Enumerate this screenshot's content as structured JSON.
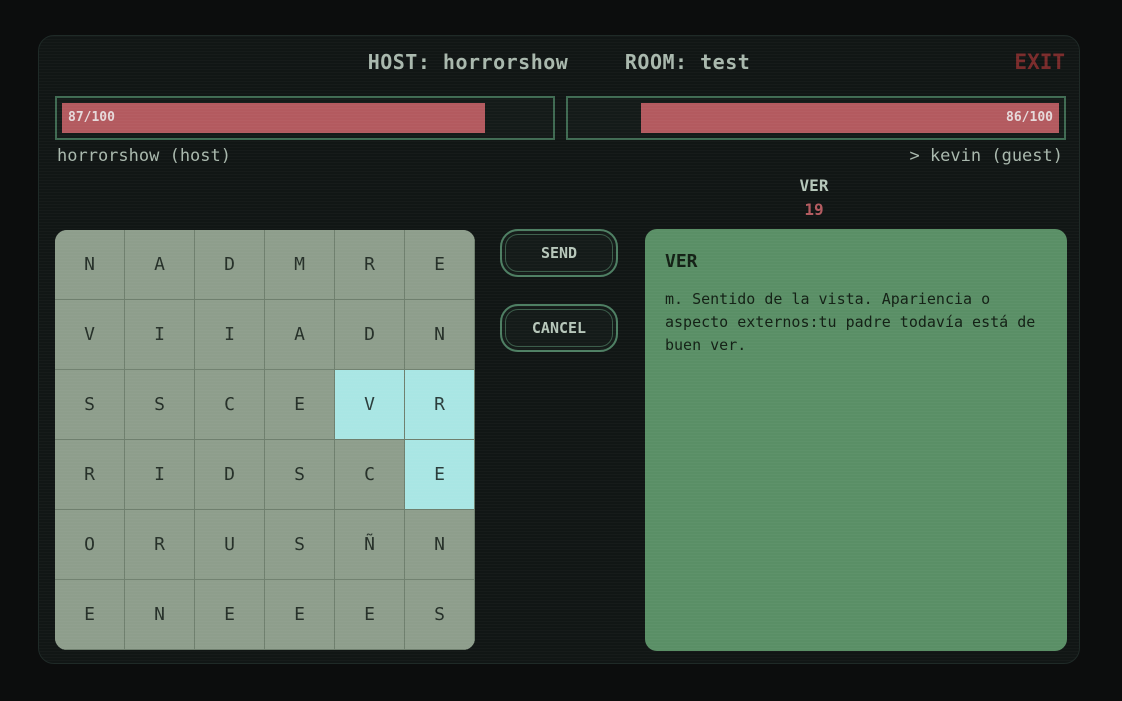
{
  "header": {
    "host_label": "HOST: horrorshow",
    "room_label": "ROOM: test",
    "exit_label": "EXIT"
  },
  "players": {
    "host": {
      "name": "horrorshow (host)",
      "hp_text": "87/100",
      "hp": 87
    },
    "guest": {
      "name": "> kevin (guest)",
      "hp_text": "86/100",
      "hp": 86
    }
  },
  "current": {
    "word": "VER",
    "score": "19"
  },
  "grid": [
    [
      "N",
      "A",
      "D",
      "M",
      "R",
      "E"
    ],
    [
      "V",
      "I",
      "I",
      "A",
      "D",
      "N"
    ],
    [
      "S",
      "S",
      "C",
      "E",
      "V",
      "R"
    ],
    [
      "R",
      "I",
      "D",
      "S",
      "C",
      "E"
    ],
    [
      "O",
      "R",
      "U",
      "S",
      "Ñ",
      "N"
    ],
    [
      "E",
      "N",
      "E",
      "E",
      "E",
      "S"
    ]
  ],
  "selected": [
    [
      2,
      4
    ],
    [
      2,
      5
    ],
    [
      3,
      5
    ]
  ],
  "buttons": {
    "send": "SEND",
    "cancel": "CANCEL"
  },
  "definition": {
    "word": "VER",
    "text": "m. Sentido de la vista. Apariencia o aspecto externos:tu padre todavía está de buen ver."
  },
  "colors": {
    "hp_fill": "#b35a5f",
    "selected_cell": "#a9e6e4",
    "definition_bg": "#5a8f66",
    "exit": "#7a2b2b"
  }
}
